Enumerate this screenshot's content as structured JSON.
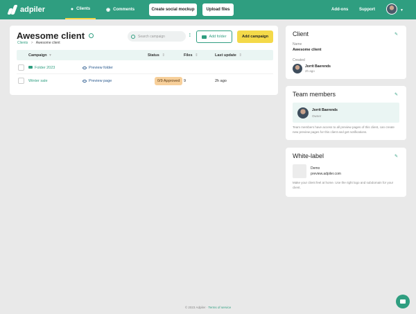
{
  "brand": {
    "name": "adpiler",
    "accent": "#2f9e80",
    "highlight": "#f4d949"
  },
  "nav": {
    "tabs": [
      {
        "label": "Clients",
        "icon": "user-icon",
        "active": true
      },
      {
        "label": "Comments",
        "icon": "comment-icon",
        "active": false
      }
    ],
    "create_mockup": "Create social mockup",
    "upload_files": "Upload files",
    "addons": "Add-ons",
    "support": "Support"
  },
  "main": {
    "title": "Awesome client",
    "breadcrumb": {
      "root": "Clients",
      "separator": ">",
      "current": "Awesome client"
    },
    "search_placeholder": "Search campaign",
    "add_folder": "Add folder",
    "add_campaign": "Add campaign",
    "columns": [
      "Campaign",
      "Status",
      "Files",
      "Last update"
    ],
    "rows": [
      {
        "name": "Folder 2023",
        "action": "Preview folder",
        "status": "",
        "files": "",
        "updated": ""
      },
      {
        "name": "Winter sale",
        "action": "Preview page",
        "status": "0/9 Approved",
        "files": "9",
        "updated": "2h ago"
      }
    ]
  },
  "client_card": {
    "title": "Client",
    "name_label": "Name",
    "name": "Awesome client",
    "created_label": "Created",
    "created_by": "Jorrit Baerends",
    "created_when": "2h ago"
  },
  "team_card": {
    "title": "Team members",
    "member_name": "Jorrit Baerends",
    "member_role": "Owner",
    "description": "Team members have access to all preview pages of this client, can create new preview pages for this client and get notifications."
  },
  "whitelabel_card": {
    "title": "White-label",
    "brand_name": "Demo",
    "domain": "preview.adpiler.com",
    "description": "Make your client feel at home. Use the right logo and subdomain for your client."
  },
  "footer": {
    "copyright": "© 2023 Adpiler · ",
    "terms": "Terms of service"
  }
}
